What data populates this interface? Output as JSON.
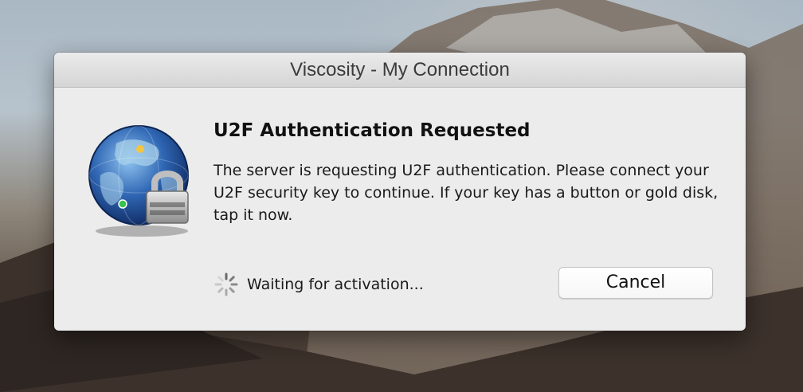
{
  "window": {
    "title": "Viscosity - My Connection"
  },
  "dialog": {
    "heading": "U2F Authentication Requested",
    "message": "The server is requesting U2F authentication. Please connect your U2F security key to continue. If your key has a button or gold disk, tap it now.",
    "status_text": "Waiting for activation...",
    "cancel_label": "Cancel",
    "app_icon": "viscosity-globe-lock-icon",
    "spinner_icon": "progress-spinner-icon"
  },
  "colors": {
    "dialog_background": "#ececec",
    "globe_blue": "#2f66b3",
    "button_border": "#c3c3c3"
  }
}
